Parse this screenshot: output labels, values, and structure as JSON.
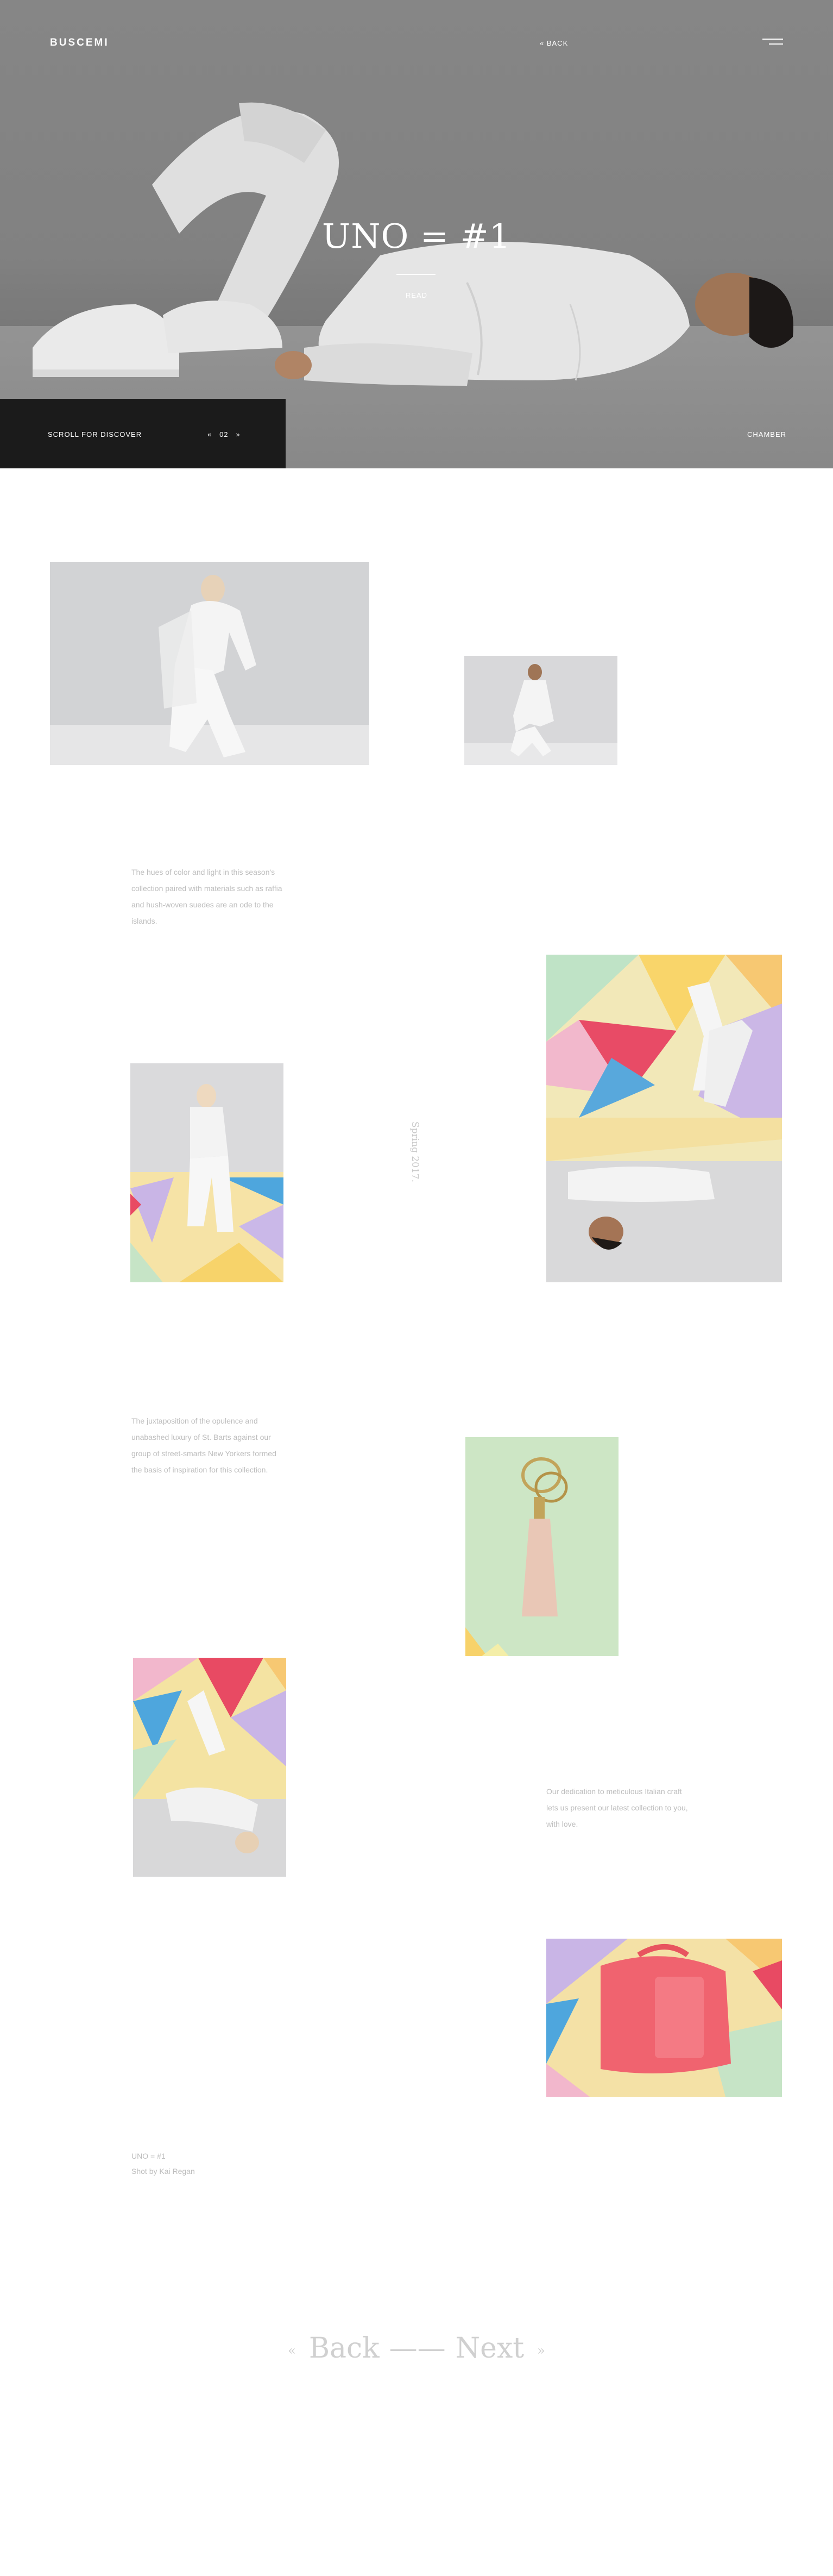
{
  "header": {
    "logo": "BUSCEMI",
    "back_label": "« BACK",
    "menu_icon": "hamburger-menu-icon"
  },
  "hero": {
    "title": "UNO = #1",
    "read_label": "READ",
    "scroll_label": "SCROLL FOR DISCOVER",
    "pager": {
      "prev": "«",
      "current": "02",
      "next": "»"
    },
    "chamber_label": "CHAMBER"
  },
  "gallery": {
    "captions": {
      "one": "The hues of color and light in this season's collection paired with materials such as raffia and hush-woven suedes are an ode to the islands.",
      "two": "The juxtaposition of the opulence and unabashed luxury of St. Barts against our group of street-smarts New Yorkers formed the basis of inspiration for this collection.",
      "three": "Our dedication to meticulous Italian craft lets us present our latest collection to you, with love."
    },
    "season": "Spring 2017.",
    "credit": {
      "line1": "UNO = #1",
      "line2": "Shot by Kai Regan"
    }
  },
  "footer_nav": {
    "prev_arrow": "«",
    "back_label": "Back",
    "separator": "——",
    "next_label": "Next",
    "next_arrow": "»"
  },
  "colors": {
    "accent_dark": "#1b1b1b",
    "muted_text": "#bdbdbd",
    "nav_text": "#d0d0d0"
  }
}
